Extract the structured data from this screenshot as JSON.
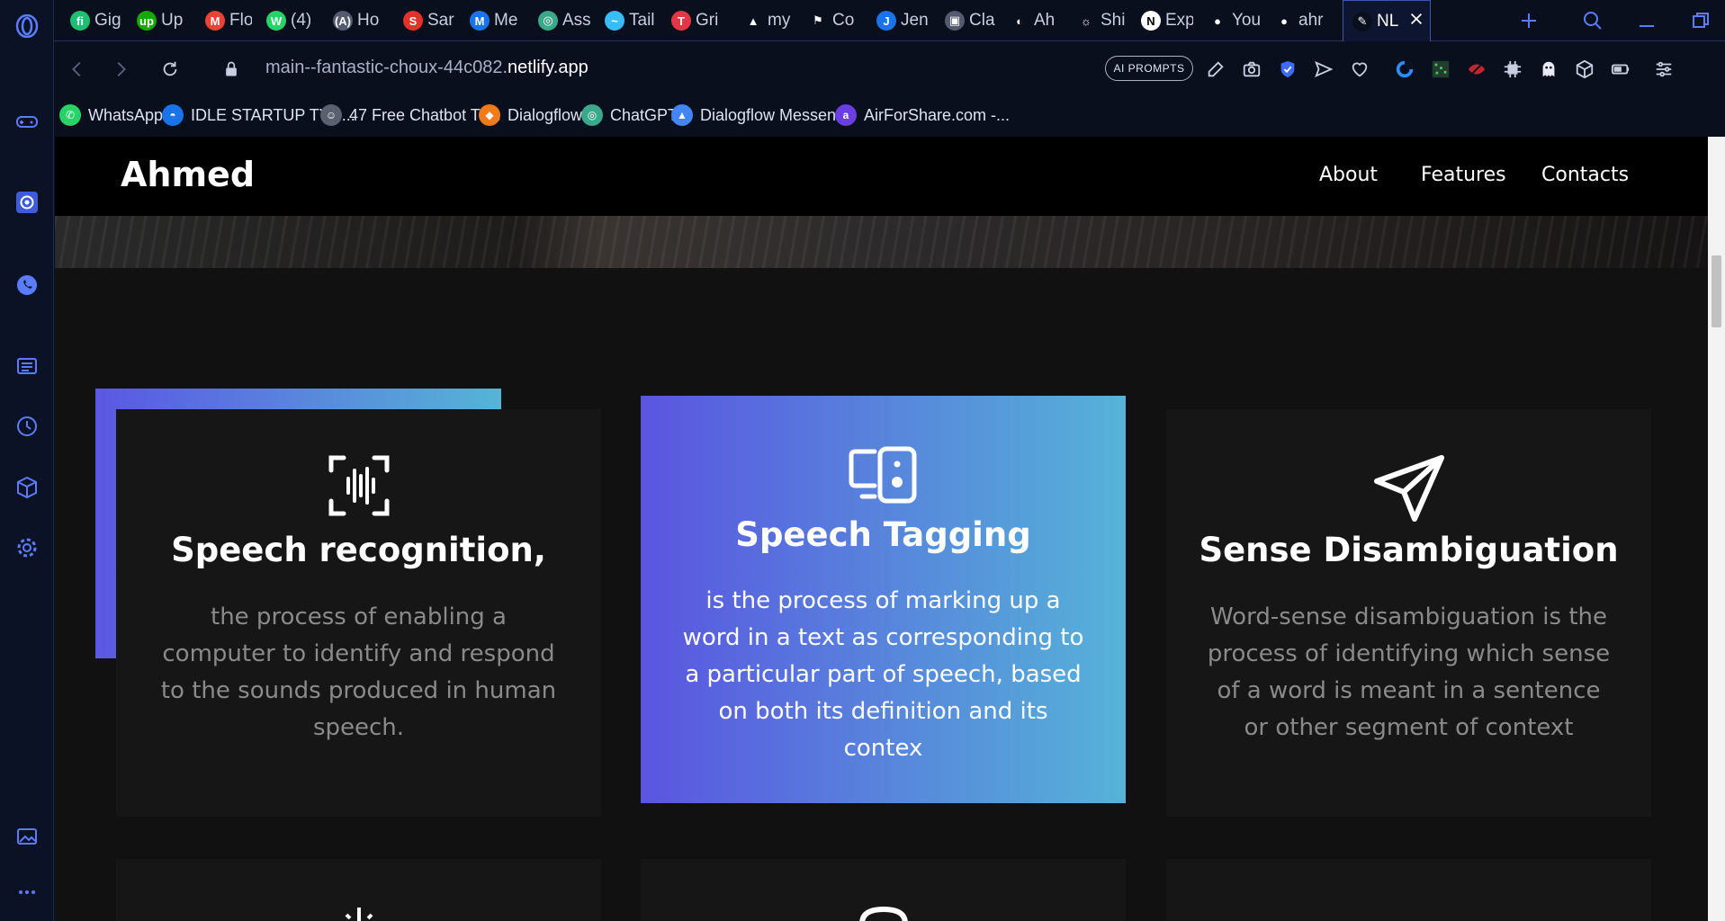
{
  "tabs": [
    {
      "label": "Gig",
      "icon": "fiverr-icon",
      "color": "#1dbf73",
      "glyph": "fi"
    },
    {
      "label": "Up",
      "icon": "upwork-icon",
      "color": "#14a800",
      "glyph": "up"
    },
    {
      "label": "Flo",
      "icon": "gmail-icon",
      "color": "#ea4335",
      "glyph": "M"
    },
    {
      "label": "(4)",
      "icon": "whatsapp-icon",
      "color": "#25d366",
      "glyph": "W"
    },
    {
      "label": "Ho",
      "icon": "react-icon",
      "color": "#555b6e",
      "glyph": "(A)"
    },
    {
      "label": "Sar",
      "icon": "scribd-icon",
      "color": "#e4322b",
      "glyph": "S"
    },
    {
      "label": "Me",
      "icon": "mail-icon",
      "color": "#1a73e8",
      "glyph": "M"
    },
    {
      "label": "Ass",
      "icon": "openai-icon",
      "color": "#3ba88a",
      "glyph": "◎"
    },
    {
      "label": "Tail",
      "icon": "tailwind-icon",
      "color": "#38bdf8",
      "glyph": "~"
    },
    {
      "label": "Gri",
      "icon": "t-icon",
      "color": "#e23744",
      "glyph": "T"
    },
    {
      "label": "my",
      "icon": "triangle-icon",
      "color": "#0a0f1e",
      "glyph": "▲"
    },
    {
      "label": "Co",
      "icon": "flag-icon",
      "color": "#0a0f1e",
      "glyph": "⚑"
    },
    {
      "label": "Jen",
      "icon": "jenni-icon",
      "color": "#1a73e8",
      "glyph": "J"
    },
    {
      "label": "Cla",
      "icon": "classroom-icon",
      "color": "#555b6e",
      "glyph": "▣"
    },
    {
      "label": "Ah",
      "icon": "globe-icon",
      "color": "#0a0f1e",
      "glyph": "◐"
    },
    {
      "label": "Shi",
      "icon": "sun-icon",
      "color": "#0a0f1e",
      "glyph": "☼"
    },
    {
      "label": "Exp",
      "icon": "notion-icon",
      "color": "#ffffff",
      "glyph": "N"
    },
    {
      "label": "You",
      "icon": "github-icon",
      "color": "#0a0f1e",
      "glyph": "●"
    },
    {
      "label": "ahr",
      "icon": "github-icon",
      "color": "#0a0f1e",
      "glyph": "●"
    },
    {
      "label": "NL",
      "icon": "nlp-icon",
      "color": "#0a0f1e",
      "glyph": "✎"
    }
  ],
  "address": {
    "url_prefix": "main--fantastic-choux-44c082.",
    "url_domain": "netlify.app",
    "ai_badge": "AI PROMPTS"
  },
  "bookmarks": [
    {
      "label": "WhatsApp",
      "color": "#25d366",
      "glyph": "✆"
    },
    {
      "label": "IDLE STARTUP TYC...",
      "color": "#1a73e8",
      "glyph": "◓"
    },
    {
      "label": "47 Free Chatbot Te...",
      "color": "#5a6070",
      "glyph": "☺"
    },
    {
      "label": "Dialogflow",
      "color": "#ef7b1a",
      "glyph": "◆"
    },
    {
      "label": "ChatGPT",
      "color": "#3ba88a",
      "glyph": "◎"
    },
    {
      "label": "Dialogflow Messen...",
      "color": "#4285f4",
      "glyph": "▲"
    },
    {
      "label": "AirForShare.com -...",
      "color": "#6a3ee0",
      "glyph": "a"
    }
  ],
  "site": {
    "brand": "Ahmed",
    "nav": [
      "About",
      "Features",
      "Contacts"
    ]
  },
  "cards": [
    {
      "title": "Speech recognition,",
      "text": "the process of enabling a computer to identify and respond to the sounds produced in human speech.",
      "icon": "voice-scan-icon"
    },
    {
      "title": "Speech Tagging",
      "text": "is the process of marking up a word in a text as corresponding to a particular part of speech, based on both its definition and its contex",
      "icon": "devices-icon"
    },
    {
      "title": "Sense Disambiguation",
      "text": "Word-sense disambiguation is the process of identifying which sense of a word is meant in a sentence or other segment of context",
      "icon": "send-icon"
    }
  ]
}
